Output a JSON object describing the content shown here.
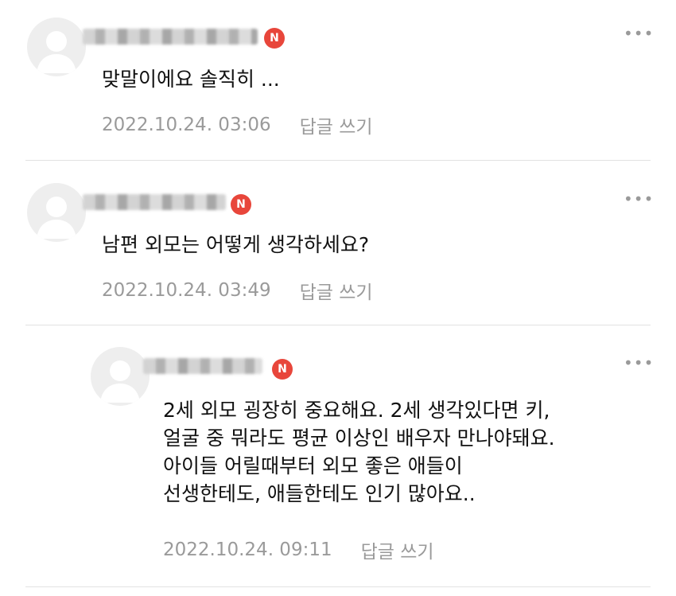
{
  "comments": [
    {
      "author_badge": "N",
      "text_lines": [
        "맞말이에요 솔직히 ..."
      ],
      "timestamp": "2022.10.24. 03:06",
      "reply_label": "답글 쓰기",
      "more_icon": "more-dots-icon"
    },
    {
      "author_badge": "N",
      "text_lines": [
        "남편 외모는 어떻게 생각하세요?"
      ],
      "timestamp": "2022.10.24. 03:49",
      "reply_label": "답글 쓰기",
      "more_icon": "more-dots-icon"
    },
    {
      "author_badge": "N",
      "text_lines": [
        "2세 외모 굉장히 중요해요. 2세 생각있다면 키,",
        "얼굴 중 뭐라도 평균 이상인 배우자 만나야돼요.",
        "아이들 어릴때부터 외모 좋은 애들이",
        "선생한테도, 애들한테도 인기 많아요.."
      ],
      "timestamp": "2022.10.24. 09:11",
      "reply_label": "답글 쓰기",
      "more_icon": "more-dots-icon"
    }
  ],
  "colors": {
    "badge": "#e8463b",
    "meta_text": "#9a9a9a",
    "divider": "#e2e2e2",
    "avatar_bg": "#eeeeee"
  }
}
